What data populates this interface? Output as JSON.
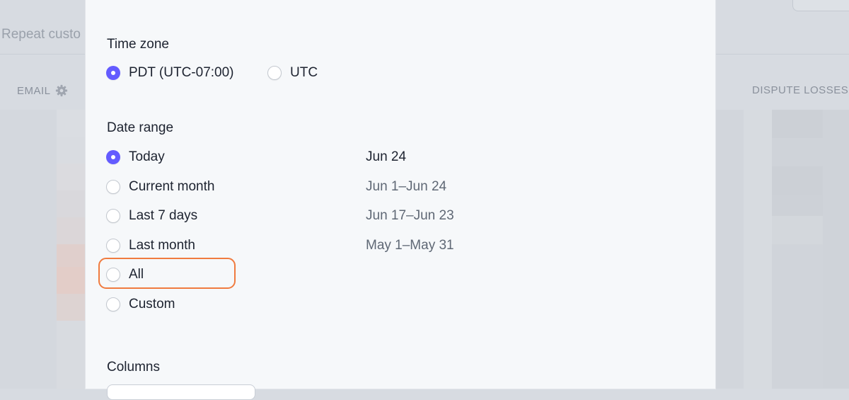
{
  "background": {
    "filter_text": "Repeat custo",
    "columns": [
      "EMAIL",
      "DISPUTE LOSSES"
    ]
  },
  "modal": {
    "timezone": {
      "title": "Time zone",
      "options": [
        {
          "label": "PDT (UTC-07:00)",
          "checked": true
        },
        {
          "label": "UTC",
          "checked": false
        }
      ]
    },
    "date_range": {
      "title": "Date range",
      "options": [
        {
          "label": "Today",
          "date": "Jun 24",
          "checked": true
        },
        {
          "label": "Current month",
          "date": "Jun 1–Jun 24",
          "checked": false
        },
        {
          "label": "Last 7 days",
          "date": "Jun 17–Jun 23",
          "checked": false
        },
        {
          "label": "Last month",
          "date": "May 1–May 31",
          "checked": false
        },
        {
          "label": "All",
          "date": "",
          "checked": false
        },
        {
          "label": "Custom",
          "date": "",
          "checked": false
        }
      ]
    },
    "columns": {
      "title": "Columns"
    }
  },
  "colors": {
    "accent": "#635bff",
    "highlight": "#f07b3f",
    "panel_bg": "#f6f8fa",
    "overlay_bg": "#d7dbe1"
  }
}
